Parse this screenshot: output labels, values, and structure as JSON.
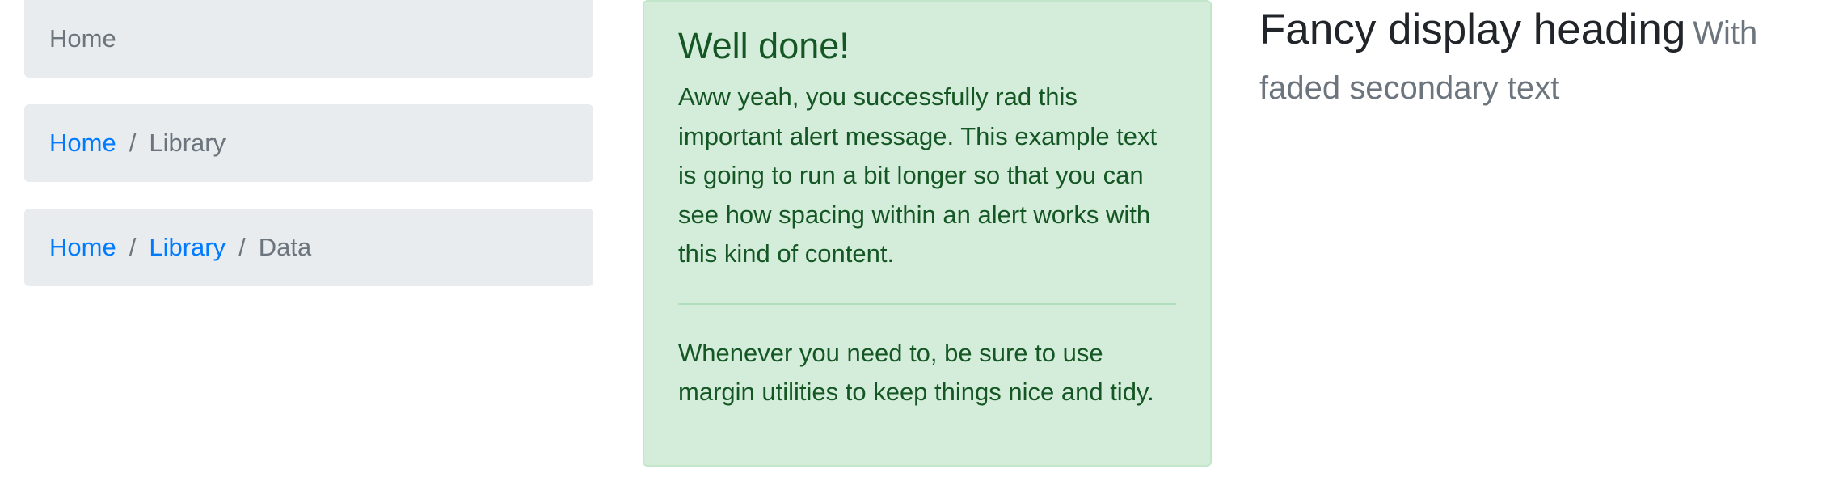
{
  "breadcrumbs": [
    {
      "items": [
        {
          "label": "Home",
          "active": true
        }
      ]
    },
    {
      "items": [
        {
          "label": "Home",
          "active": false
        },
        {
          "label": "Library",
          "active": true
        }
      ]
    },
    {
      "items": [
        {
          "label": "Home",
          "active": false
        },
        {
          "label": "Library",
          "active": false
        },
        {
          "label": "Data",
          "active": true
        }
      ]
    }
  ],
  "breadcrumb_separator": "/",
  "alert": {
    "heading": "Well done!",
    "body": "Aww yeah, you successfully rad this important alert message. This example text is going to run a bit longer so that you can see how spacing within an alert works with this kind of content.",
    "footer": "Whenever you need to, be sure to use margin utilities to keep things nice and tidy."
  },
  "display_heading": {
    "main": "Fancy display heading",
    "secondary": "With faded secondary text"
  },
  "colors": {
    "link": "#007bff",
    "muted": "#6c757d",
    "breadcrumb_bg": "#e9ecef",
    "alert_bg": "#d4edda",
    "alert_text": "#155724"
  }
}
